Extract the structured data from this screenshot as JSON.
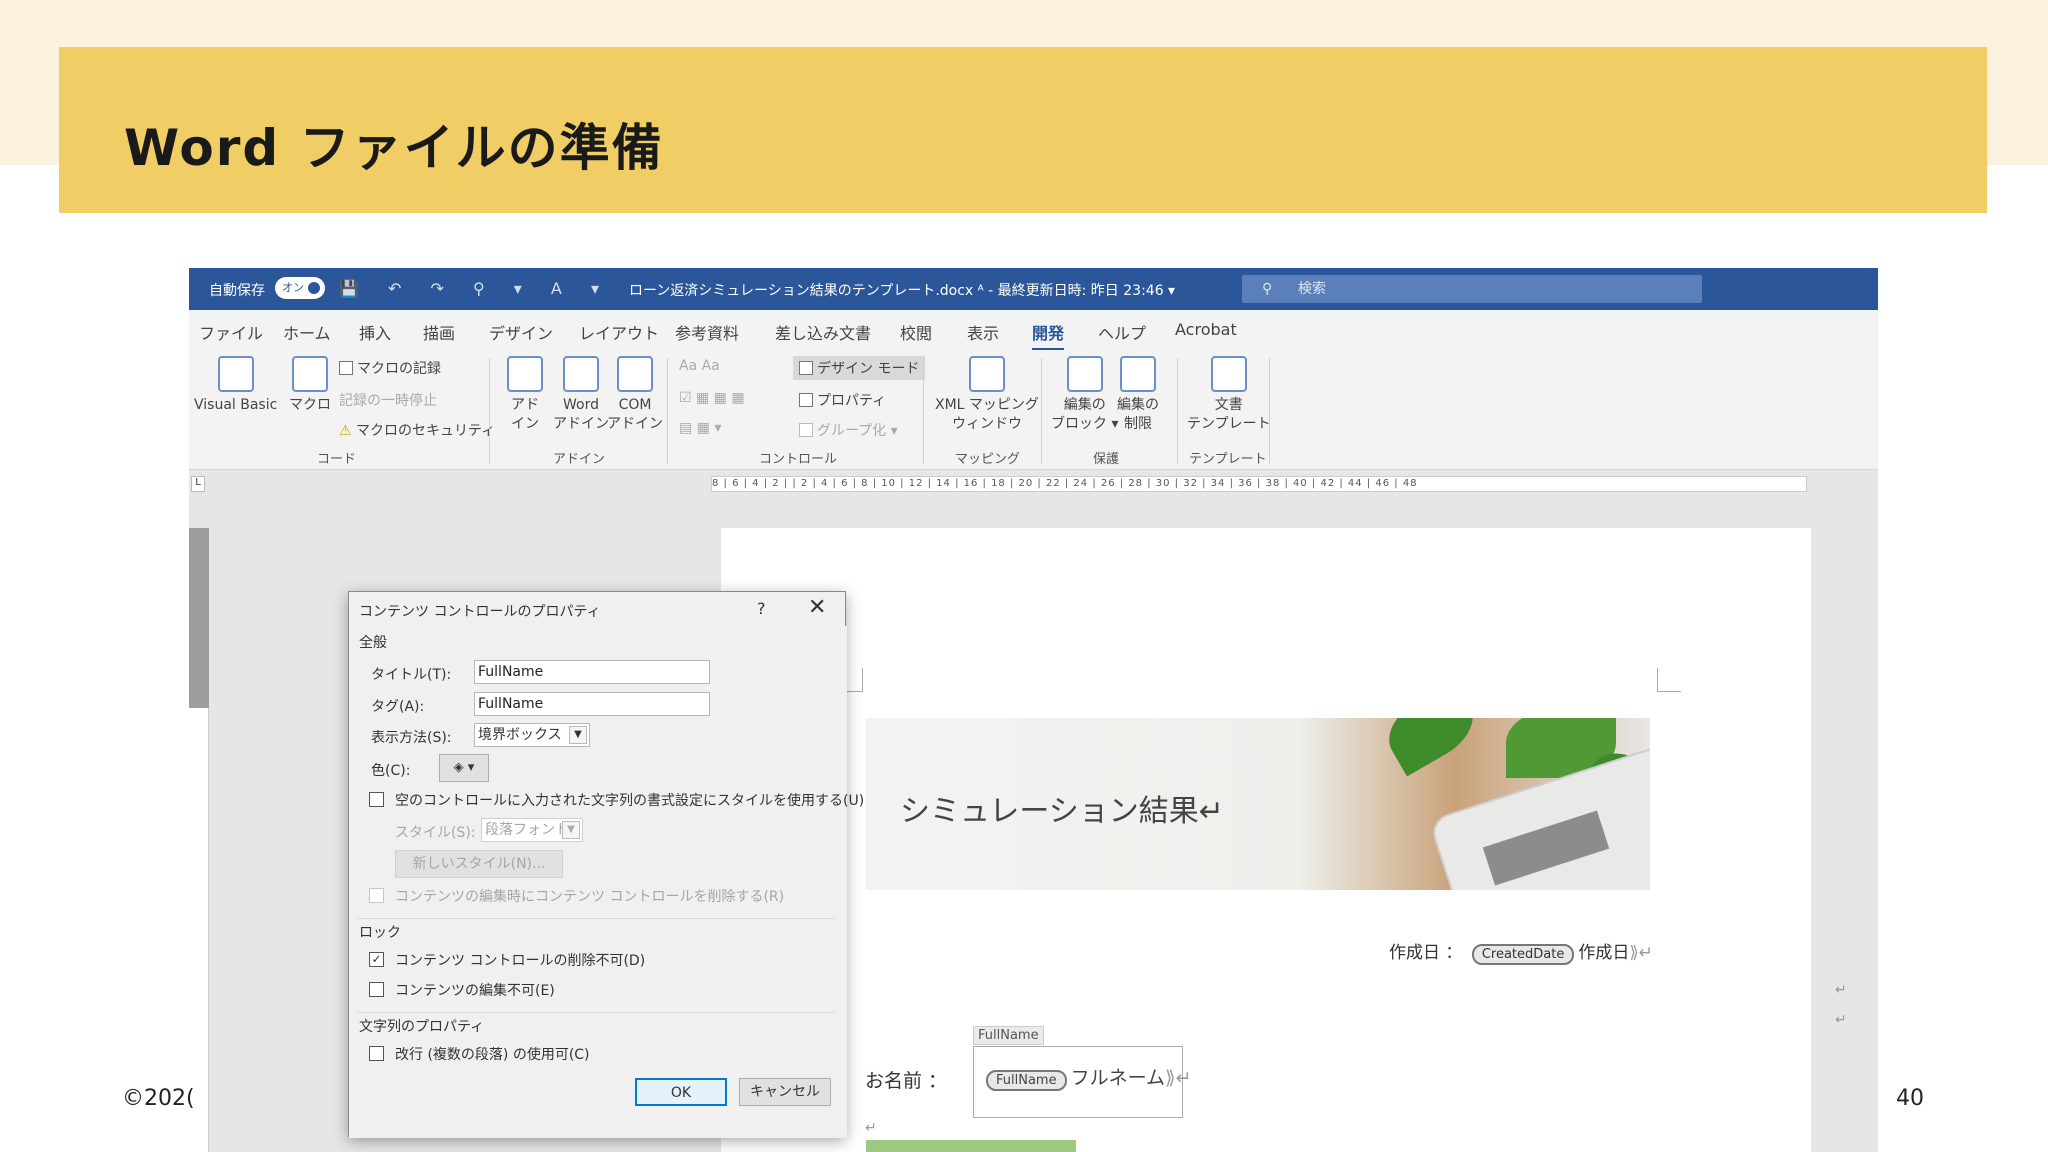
{
  "slide": {
    "title": "Word ファイルの準備",
    "copyright": "©202(",
    "page_number": "40"
  },
  "word": {
    "titlebar": {
      "autosave_label": "自動保存",
      "autosave_state": "オン",
      "quick_icons": "💾 ↶ ↷ ⚲ ▾ A ▾",
      "document_title": "ローン返済シミュレーション結果のテンプレート.docx  ᴬ  -  最終更新日時: 昨日 23:46  ▾",
      "search_placeholder": "検索"
    },
    "menu": [
      "ファイル",
      "ホーム",
      "挿入",
      "描画",
      "デザイン",
      "レイアウト",
      "参考資料",
      "差し込み文書",
      "校閲",
      "表示",
      "開発",
      "ヘルプ",
      "Acrobat"
    ],
    "active_menu": "開発",
    "ribbon": {
      "code": {
        "visual_basic": "Visual Basic",
        "macro": "マクロ",
        "record_macro": "マクロの記録",
        "pause_record": "記録の一時停止",
        "macro_security": "マクロのセキュリティ",
        "group": "コード"
      },
      "addin": {
        "addin_1": "アド",
        "addin_2": "イン",
        "word_addin_1": "Word",
        "word_addin_2": "アドイン",
        "com_addin_1": "COM",
        "com_addin_2": "アドイン",
        "group": "アドイン"
      },
      "controls": {
        "design_mode": "デザイン モード",
        "properties": "プロパティ",
        "group_btn": "グループ化",
        "text_controls": "Aa  Aa",
        "group": "コントロール"
      },
      "mapping": {
        "xml_1": "XML マッピング",
        "xml_2": "ウィンドウ",
        "group": "マッピング"
      },
      "protect": {
        "block_1": "編集の",
        "block_2": "ブロック ▾",
        "restrict_1": "編集の",
        "restrict_2": "制限",
        "group": "保護"
      },
      "template": {
        "doc_template_1": "文書",
        "doc_template_2": "テンプレート",
        "group": "テンプレート"
      }
    },
    "ruler_text": "8 | 6 | 4 | 2 |  | 2 | 4 | 6 | 8 | 10 | 12 | 14 | 16 | 18 | 20 | 22 | 24 | 26 | 28 | 30 | 32 | 34 | 36 | 38 | 40 | 42 | 44 | 46 | 48",
    "document": {
      "banner_title": "シミュレーション結果↵",
      "date_label": "作成日 ：",
      "date_tag": "CreatedDate",
      "date_placeholder": "作成日",
      "name_tag_title": "FullName",
      "name_label": "お名前 ：",
      "name_tag": "FullName",
      "name_placeholder": "フルネーム"
    },
    "dialog": {
      "title": "コンテンツ コントロールのプロパティ",
      "help": "?",
      "close": "✕",
      "section_general": "全般",
      "title_label": "タイトル(T):",
      "title_value": "FullName",
      "tag_label": "タグ(A):",
      "tag_value": "FullName",
      "display_label": "表示方法(S):",
      "display_value": "境界ボックス",
      "color_label": "色(C):",
      "use_style_label": "空のコントロールに入力された文字列の書式設定にスタイルを使用する(U)",
      "style_label": "スタイル(S):",
      "style_value": "段落フォント",
      "new_style": "新しいスタイル(N)...",
      "remove_on_edit": "コンテンツの編集時にコンテンツ コントロールを削除する(R)",
      "section_lock": "ロック",
      "lock_delete": "コンテンツ コントロールの削除不可(D)",
      "lock_edit": "コンテンツの編集不可(E)",
      "section_text": "文字列のプロパティ",
      "allow_return": "改行 (複数の段落) の使用可(C)",
      "ok": "OK",
      "cancel": "キャンセル"
    }
  }
}
